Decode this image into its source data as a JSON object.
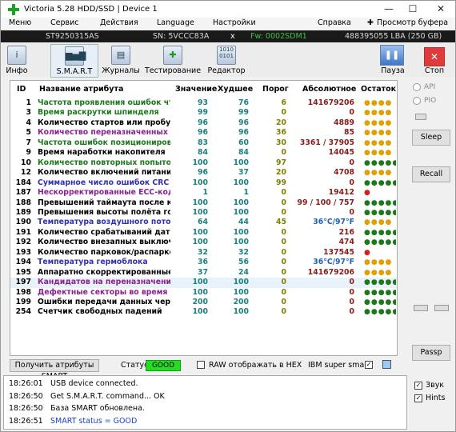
{
  "window": {
    "title": "Victoria 5.28 HDD/SSD | Device 1",
    "min": "—",
    "max": "☐",
    "close": "✕"
  },
  "menu": [
    "Меню",
    "Сервис",
    "Действия",
    "Language",
    "Настройки",
    "Справка",
    "Просмотр буфера"
  ],
  "device": {
    "model": "ST9250315AS",
    "sn": "SN: 5VCCC83A",
    "x": "x",
    "fw": "Fw: 0002SDM1",
    "lba": "488395055 LBA (250 GB)"
  },
  "toolbar": {
    "info": "Инфо",
    "smart": "S.M.A.R.T",
    "journals": "Журналы",
    "testing": "Тестирование",
    "editor": "Редактор",
    "pause": "Пауза",
    "stop": "Стоп"
  },
  "table": {
    "headers": {
      "id": "ID",
      "name": "Название атрибута",
      "value": "Значение",
      "worst": "Худшее",
      "threshold": "Порог",
      "absolute": "Абсолютное",
      "remaining": "Остаток"
    },
    "rows": [
      {
        "id": "1",
        "name": "Частота проявления ошибок чтения",
        "value": "93",
        "worst": "76",
        "thr": "6",
        "abs": "141679206",
        "st": "●●●●",
        "nc": "#1a7a1a",
        "vc": "#1a8080",
        "sc": "#e0a000"
      },
      {
        "id": "3",
        "name": "Время раскрутки шпинделя",
        "value": "99",
        "worst": "99",
        "thr": "0",
        "abs": "0",
        "st": "●●●●",
        "nc": "#1a7a1a",
        "vc": "#1a8080",
        "sc": "#e0a000"
      },
      {
        "id": "4",
        "name": "Количество стартов или пробужде...",
        "value": "96",
        "worst": "96",
        "thr": "20",
        "abs": "4889",
        "st": "●●●●",
        "nc": "#000",
        "vc": "#1a8080",
        "sc": "#e0a000"
      },
      {
        "id": "5",
        "name": "Количество переназначенных сект...",
        "value": "96",
        "worst": "96",
        "thr": "36",
        "abs": "85",
        "st": "●●●●",
        "nc": "#8a2090",
        "vc": "#1a8080",
        "sc": "#e0a000"
      },
      {
        "id": "7",
        "name": "Частота ошибок позиционирования",
        "value": "83",
        "worst": "60",
        "thr": "30",
        "abs": "3361 / 37905",
        "st": "●●●●",
        "nc": "#1a7a1a",
        "vc": "#1a8080",
        "sc": "#e0a000"
      },
      {
        "id": "9",
        "name": "Время наработки накопителя",
        "value": "84",
        "worst": "84",
        "thr": "0",
        "abs": "14045",
        "st": "●●●●",
        "nc": "#000",
        "vc": "#1a8080",
        "sc": "#e0a000"
      },
      {
        "id": "10",
        "name": "Количество повторных попыток р...",
        "value": "100",
        "worst": "100",
        "thr": "97",
        "abs": "0",
        "st": "●●●●●",
        "nc": "#1a7a1a",
        "vc": "#1a8080",
        "sc": "#1a7a1a"
      },
      {
        "id": "12",
        "name": "Количество включений питания",
        "value": "96",
        "worst": "37",
        "thr": "20",
        "abs": "4708",
        "st": "●●●●",
        "nc": "#000",
        "vc": "#1a8080",
        "sc": "#e0a000"
      },
      {
        "id": "184",
        "name": "Суммарное число ошибок CRC",
        "value": "100",
        "worst": "100",
        "thr": "99",
        "abs": "0",
        "st": "●●●●●",
        "nc": "#3030b0",
        "vc": "#1a8080",
        "sc": "#1a7a1a"
      },
      {
        "id": "187",
        "name": "Нескорректированные ECC-кодом ...",
        "value": "1",
        "worst": "1",
        "thr": "0",
        "abs": "19412",
        "st": "●",
        "nc": "#8a2090",
        "vc": "#1a8080",
        "sc": "#d02020"
      },
      {
        "id": "188",
        "name": "Превышений таймаута после кома...",
        "value": "100",
        "worst": "100",
        "thr": "0",
        "abs": "99 / 100 / 757",
        "st": "●●●●●",
        "nc": "#000",
        "vc": "#1a8080",
        "sc": "#1a7a1a"
      },
      {
        "id": "189",
        "name": "Превышения высоты полёта голов...",
        "value": "100",
        "worst": "100",
        "thr": "0",
        "abs": "0",
        "st": "●●●●●",
        "nc": "#000",
        "vc": "#1a8080",
        "sc": "#1a7a1a"
      },
      {
        "id": "190",
        "name": "Температура воздушного потока",
        "value": "64",
        "worst": "44",
        "thr": "45",
        "abs": "36°C/97°F",
        "st": "●●●●",
        "nc": "#3030b0",
        "vc": "#1a8080",
        "sc": "#e0a000",
        "ac": "#1a60c0"
      },
      {
        "id": "191",
        "name": "Количество срабатываний датчика...",
        "value": "100",
        "worst": "100",
        "thr": "0",
        "abs": "216",
        "st": "●●●●●",
        "nc": "#000",
        "vc": "#1a8080",
        "sc": "#1a7a1a"
      },
      {
        "id": "192",
        "name": "Количество внезапных выключени...",
        "value": "100",
        "worst": "100",
        "thr": "0",
        "abs": "474",
        "st": "●●●●●",
        "nc": "#000",
        "vc": "#1a8080",
        "sc": "#1a7a1a"
      },
      {
        "id": "193",
        "name": "Количество парковок/распарковок",
        "value": "32",
        "worst": "32",
        "thr": "0",
        "abs": "137545",
        "st": "●",
        "nc": "#000",
        "vc": "#1a8080",
        "sc": "#d02020"
      },
      {
        "id": "194",
        "name": "Температура гермоблока",
        "value": "36",
        "worst": "56",
        "thr": "0",
        "abs": "36°C/97°F",
        "st": "●●●●",
        "nc": "#3030b0",
        "vc": "#1a8080",
        "sc": "#e0a000",
        "ac": "#1a60c0"
      },
      {
        "id": "195",
        "name": "Аппаратно скорректированные ош...",
        "value": "37",
        "worst": "24",
        "thr": "0",
        "abs": "141679206",
        "st": "●●●●",
        "nc": "#000",
        "vc": "#1a8080",
        "sc": "#e0a000"
      },
      {
        "id": "197",
        "name": "Кандидатов на переназначение",
        "value": "100",
        "worst": "100",
        "thr": "0",
        "abs": "0",
        "st": "●●●●●",
        "nc": "#8a2090",
        "vc": "#1a8080",
        "sc": "#1a7a1a",
        "sel": true
      },
      {
        "id": "198",
        "name": "Дефектные секторы во время сам...",
        "value": "100",
        "worst": "100",
        "thr": "0",
        "abs": "0",
        "st": "●●●●●",
        "nc": "#8a2090",
        "vc": "#1a8080",
        "sc": "#1a7a1a"
      },
      {
        "id": "199",
        "name": "Ошибки передачи данных через D...",
        "value": "200",
        "worst": "200",
        "thr": "0",
        "abs": "0",
        "st": "●●●●●",
        "nc": "#000",
        "vc": "#1a8080",
        "sc": "#1a7a1a"
      },
      {
        "id": "254",
        "name": "Счетчик свободных падений",
        "value": "100",
        "worst": "100",
        "thr": "0",
        "abs": "0",
        "st": "●●●●●",
        "nc": "#000",
        "vc": "#1a8080",
        "sc": "#1a7a1a"
      }
    ]
  },
  "side": {
    "api": "API",
    "pio": "PIO",
    "sleep": "Sleep",
    "recall": "Recall",
    "passp": "Passp"
  },
  "bottom": {
    "get_attrs": "Получить атрибуты SMART",
    "status_label": "Статус:",
    "status_value": "GOOD",
    "raw_label": "RAW отображать в HEX",
    "ibm_label": "IBM super smart:",
    "ibm_check": "✓"
  },
  "log": [
    {
      "time": "18:26:01",
      "msg": "USB device connected.",
      "color": "#000"
    },
    {
      "time": "18:26:50",
      "msg": "Get S.M.A.R.T. command... OK",
      "color": "#000"
    },
    {
      "time": "18:26:50",
      "msg": "База SMART обновлена.",
      "color": "#000"
    },
    {
      "time": "18:26:51",
      "msg": "SMART status = GOOD",
      "color": "#1a40c0"
    }
  ],
  "options": {
    "sound": "Звук",
    "hints": "Hints",
    "sound_check": "✓",
    "hints_check": "✓"
  },
  "colors": {
    "good": "#22dd22",
    "selected_row": "#e8f2fb"
  }
}
